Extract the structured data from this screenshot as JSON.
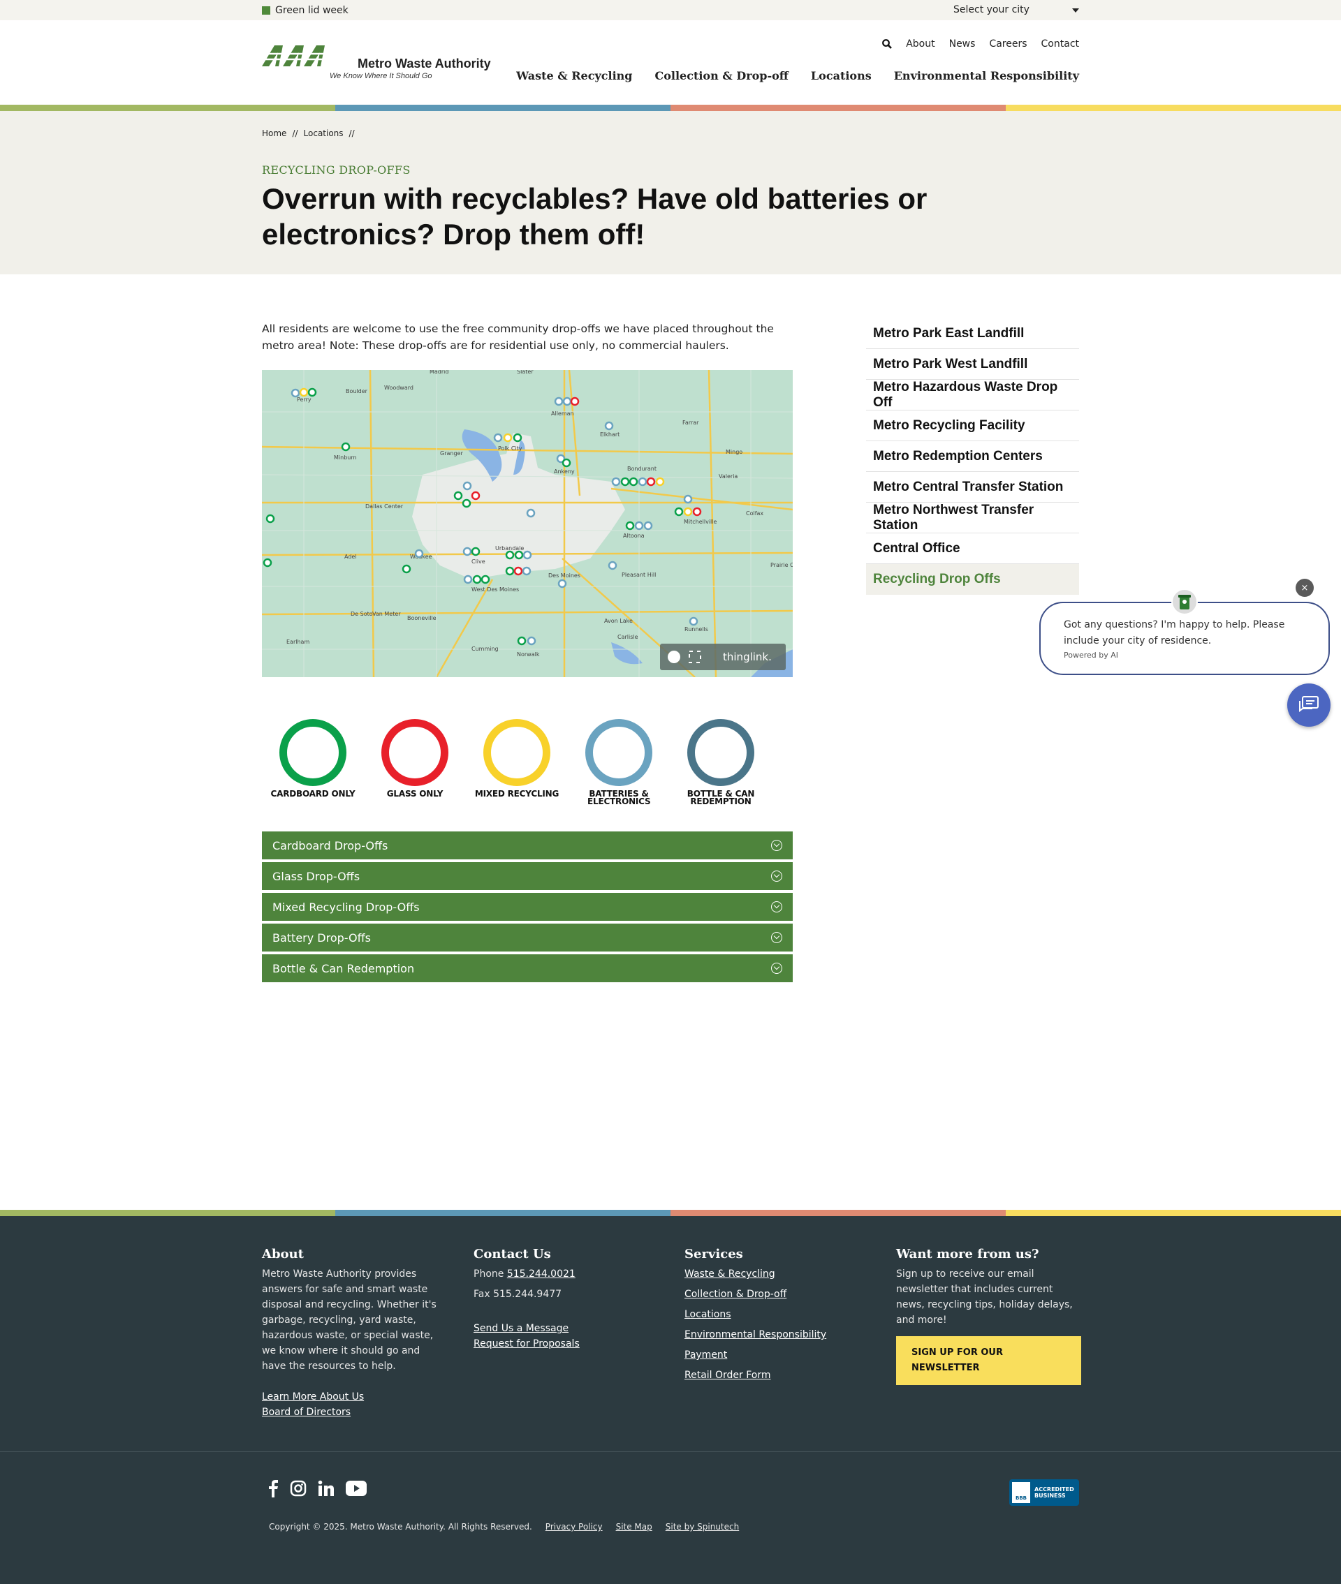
{
  "utility": {
    "notice": "Green lid week",
    "city_select": "Select your city"
  },
  "logo": {
    "name": "Metro Waste Authority",
    "tagline": "We Know Where It Should Go"
  },
  "util_nav": [
    "About",
    "News",
    "Careers",
    "Contact"
  ],
  "main_nav": [
    "Waste & Recycling",
    "Collection & Drop-off",
    "Locations",
    "Environmental Responsibility"
  ],
  "colors": {
    "green": "#a2b862",
    "blue": "#5c98b6",
    "salmon": "#df8a72",
    "yellow": "#f7dc5f",
    "brand_green": "#4e843c",
    "footer_bg": "#2c3a40"
  },
  "breadcrumb": {
    "home": "Home",
    "sep": "//",
    "locations": "Locations"
  },
  "hero": {
    "eyebrow": "RECYCLING DROP-OFFS",
    "title": "Overrun with recyclables? Have old batteries or electronics? Drop them off!"
  },
  "intro": "All residents are welcome to use the free community drop-offs we have placed throughout the metro area! Note: These drop-offs are for residential use only, no commercial haulers.",
  "map": {
    "places": [
      "Madrid",
      "Slater",
      "Woodward",
      "Boulder",
      "Perry",
      "Alleman",
      "Elkhart",
      "Polk City",
      "Minburn",
      "Granger",
      "Ankeny",
      "Bondurant",
      "Dallas Center",
      "Mitchellville",
      "Colfax",
      "Adel",
      "Waukee",
      "Clive",
      "Urbandale",
      "Altoona",
      "Des Moines",
      "West Des Moines",
      "Pleasant Hill",
      "Prairie City",
      "De Soto",
      "Van Meter",
      "Booneville",
      "Earlham",
      "Avon Lake",
      "Runnells",
      "Carlisle",
      "Cumming",
      "Norwalk",
      "Farrar",
      "Mingo",
      "Valeria"
    ],
    "watermark": "thinglink."
  },
  "legend": [
    {
      "label": "CARDBOARD ONLY",
      "color": "#0aa04a"
    },
    {
      "label": "GLASS ONLY",
      "color": "#e8202a"
    },
    {
      "label": "MIXED RECYCLING",
      "color": "#f8d12a"
    },
    {
      "label": "BATTERIES & ELECTRONICS",
      "color": "#6aa3c0"
    },
    {
      "label": "BOTTLE & CAN REDEMPTION",
      "color": "#4a7589"
    }
  ],
  "accordion": [
    "Cardboard Drop-Offs",
    "Glass Drop-Offs",
    "Mixed Recycling Drop-Offs",
    "Battery Drop-Offs",
    "Bottle & Can Redemption"
  ],
  "sidebar": [
    "Metro Park East Landfill",
    "Metro Park West Landfill",
    "Metro Hazardous Waste Drop Off",
    "Metro Recycling Facility",
    "Metro Redemption Centers",
    "Metro Central Transfer Station",
    "Metro Northwest Transfer Station",
    "Central Office",
    "Recycling Drop Offs"
  ],
  "chat": {
    "message": "Got any questions? I'm happy to help. Please include your city of residence.",
    "powered": "Powered by AI",
    "close": "×"
  },
  "footer": {
    "about": {
      "heading": "About",
      "text": "Metro Waste Authority provides answers for safe and smart waste disposal and recycling. Whether it's garbage, recycling, yard waste, hazardous waste, or special waste, we know where it should go and have the resources to help.",
      "links": [
        "Learn More About Us",
        "Board of Directors"
      ]
    },
    "contact": {
      "heading": "Contact Us",
      "phone_label": "Phone",
      "phone": "515.244.0021",
      "fax": "Fax 515.244.9477",
      "links": [
        "Send Us a Message",
        "Request for Proposals"
      ]
    },
    "services": {
      "heading": "Services",
      "links": [
        "Waste & Recycling",
        "Collection & Drop-off",
        "Locations",
        "Environmental Responsibility",
        "Payment",
        "Retail Order Form"
      ]
    },
    "newsletter": {
      "heading": "Want more from us?",
      "text": "Sign up to receive our email newsletter that includes current news, recycling tips, holiday delays, and more!",
      "button": "SIGN UP FOR OUR NEWSLETTER"
    },
    "bbb": {
      "line1": "ACCREDITED",
      "line2": "BUSINESS",
      "mark": "BBB"
    },
    "copyright": "Copyright © 2025. Metro Waste Authority. All Rights Reserved.",
    "legal_links": [
      "Privacy Policy",
      "Site Map",
      "Site by Spinutech"
    ]
  }
}
